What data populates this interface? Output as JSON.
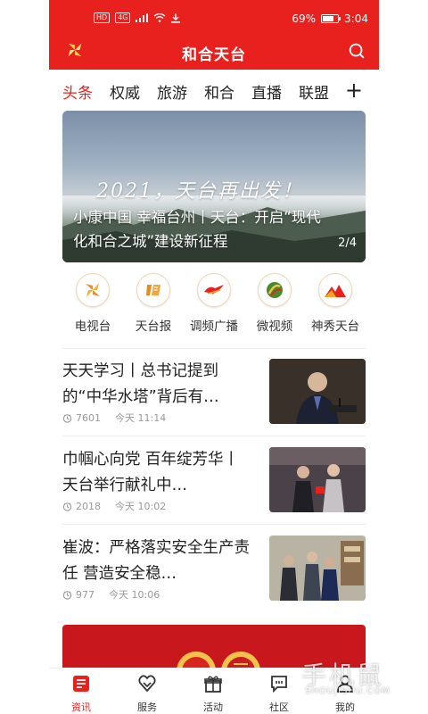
{
  "status_bar": {
    "left_badges": [
      "HD",
      "4G"
    ],
    "battery": "69%",
    "time": "3:04"
  },
  "app_bar": {
    "title": "和合天台",
    "logo_icon": "pinwheel-logo-icon",
    "search_icon": "search-icon"
  },
  "tabs": [
    {
      "label": "头条",
      "active": true
    },
    {
      "label": "权威",
      "active": false
    },
    {
      "label": "旅游",
      "active": false
    },
    {
      "label": "和合",
      "active": false
    },
    {
      "label": "直播",
      "active": false
    },
    {
      "label": "联盟",
      "active": false
    }
  ],
  "tab_add_label": "+",
  "banner": {
    "slogan": "2021，天台再出发！",
    "caption": "小康中国 幸福台州丨天台：开启“现代化和合之城”建设新征程",
    "counter": "2/4"
  },
  "shortcuts": [
    {
      "label": "电视台",
      "icon": "tv-station-icon"
    },
    {
      "label": "天台报",
      "icon": "newspaper-icon"
    },
    {
      "label": "调频广播",
      "icon": "radio-icon"
    },
    {
      "label": "微视频",
      "icon": "micro-video-icon"
    },
    {
      "label": "神秀天台",
      "icon": "mountain-icon"
    }
  ],
  "news": [
    {
      "title": "天天学习丨总书记提到的“中华水塔”背后有…",
      "views": "7601",
      "time": "今天 11:14"
    },
    {
      "title": "巾帼心向党 百年绽芳华丨 天台举行献礼中…",
      "views": "2018",
      "time": "今天 10:02"
    },
    {
      "title": "崔波：严格落实安全生产责任 营造安全稳…",
      "views": "977",
      "time": "今天 10:06"
    }
  ],
  "bottom_nav": [
    {
      "label": "资讯",
      "icon": "news-icon",
      "active": true
    },
    {
      "label": "服务",
      "icon": "service-icon",
      "active": false
    },
    {
      "label": "活动",
      "icon": "gift-icon",
      "active": false
    },
    {
      "label": "社区",
      "icon": "chat-icon",
      "active": false
    },
    {
      "label": "我的",
      "icon": "user-icon",
      "active": false
    }
  ],
  "watermark": {
    "text": "手机鼠",
    "sub": "SHOUJISHU.COM"
  },
  "colors": {
    "brand_red": "#e8211e",
    "text": "#222222",
    "meta": "#999999"
  }
}
